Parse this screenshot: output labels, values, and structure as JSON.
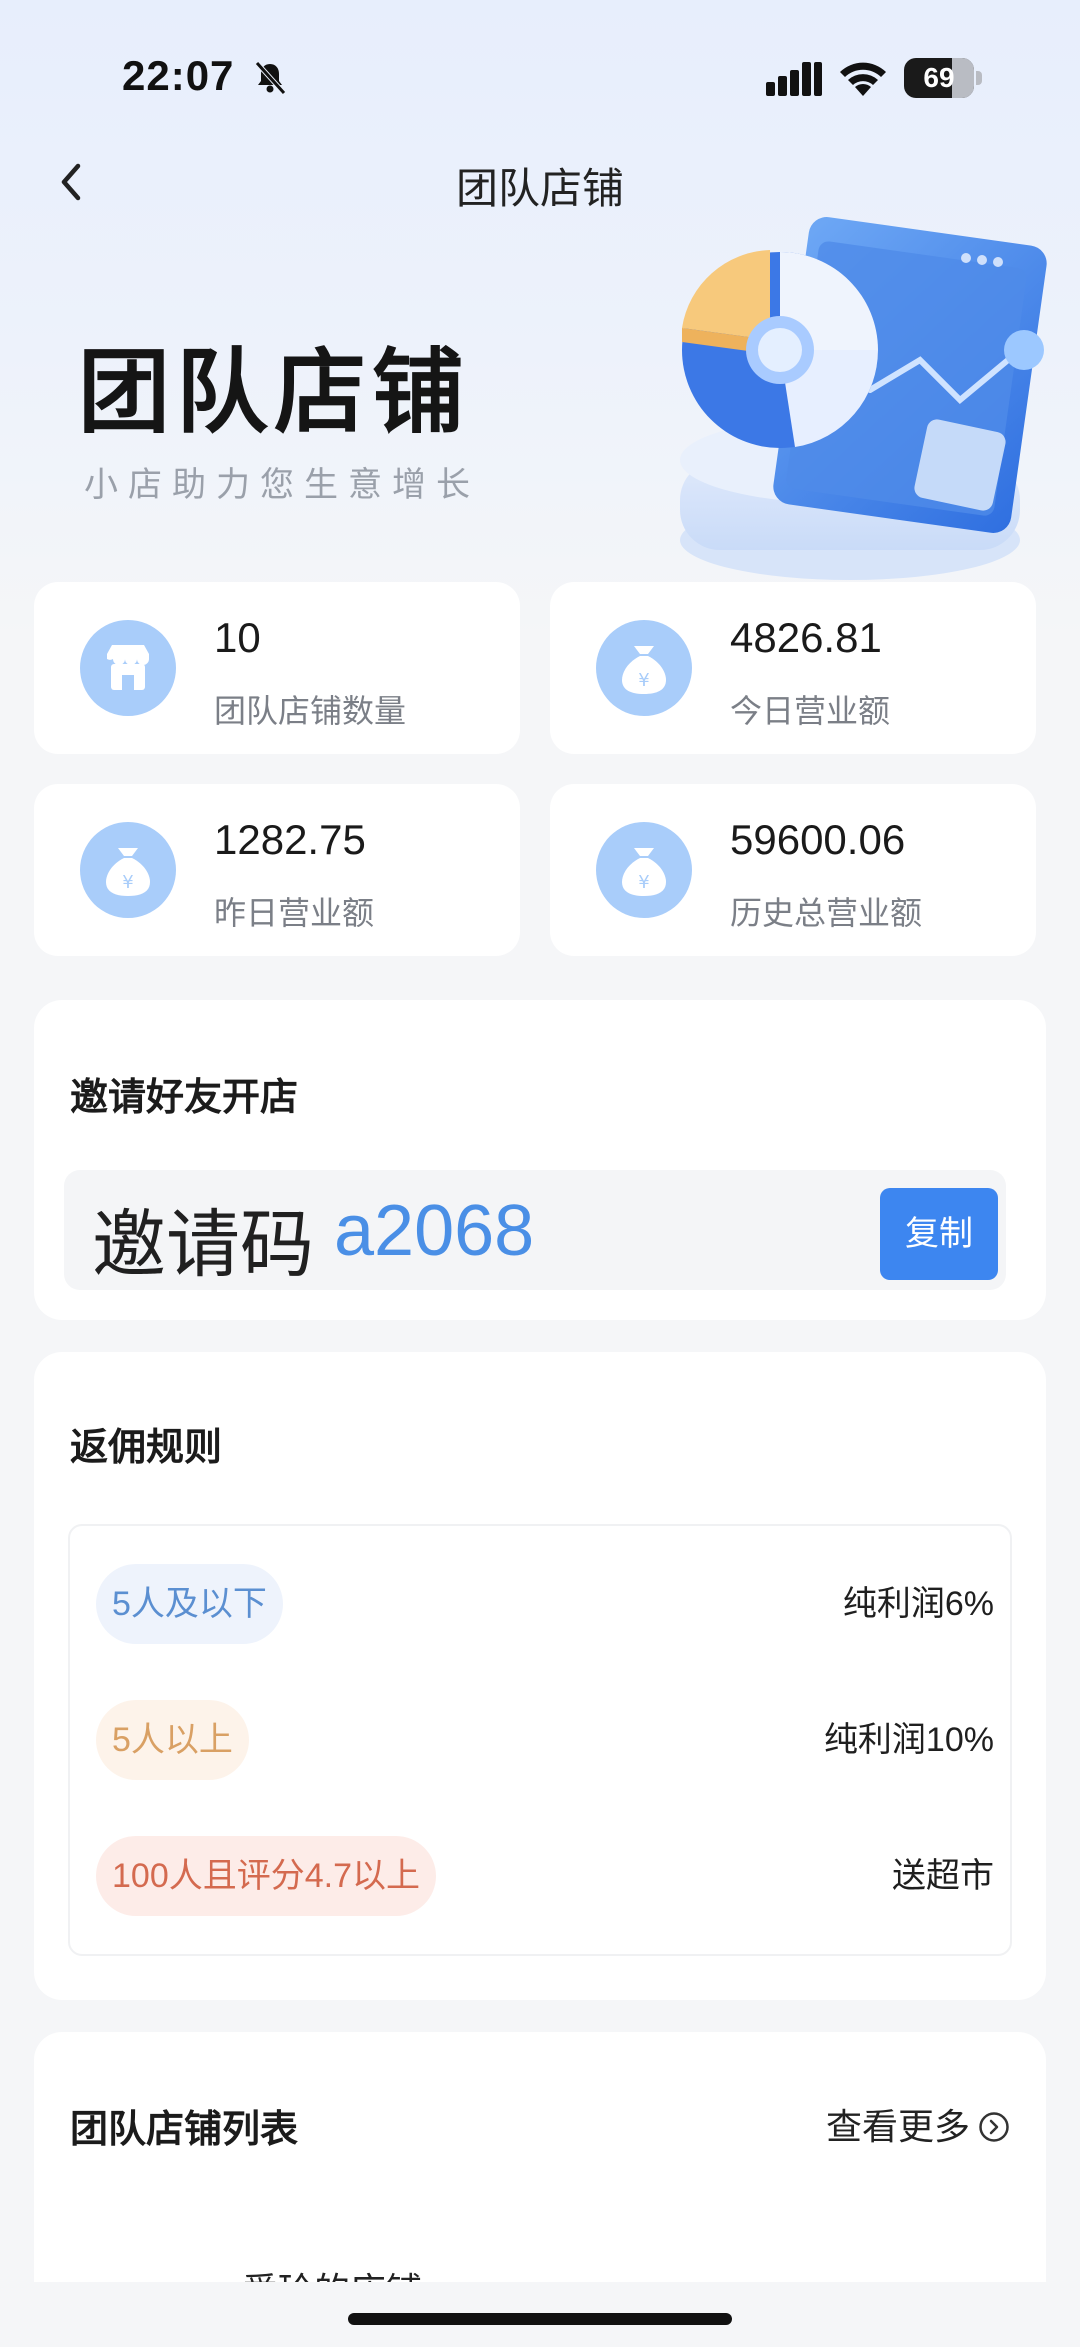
{
  "status_bar": {
    "time": "22:07",
    "battery": "69",
    "battery_level": 0.69
  },
  "nav": {
    "title": "团队店铺"
  },
  "hero": {
    "title": "团队店铺",
    "subtitle": "小店助力您生意增长"
  },
  "stats": [
    {
      "value": "10",
      "label": "团队店铺数量",
      "icon": "store-icon"
    },
    {
      "value": "4826.81",
      "label": "今日营业额",
      "icon": "money-bag-icon"
    },
    {
      "value": "1282.75",
      "label": "昨日营业额",
      "icon": "money-bag-icon"
    },
    {
      "value": "59600.06",
      "label": "历史总营业额",
      "icon": "money-bag-icon"
    }
  ],
  "invite": {
    "title": "邀请好友开店",
    "label": "邀请码",
    "code": "a2068",
    "copy_label": "复制"
  },
  "rules": {
    "title": "返佣规则",
    "rows": [
      {
        "tag": "5人及以下",
        "value": "纯利润6%",
        "tag_color": "#5b8fd1",
        "tag_bg": "#eef3fc"
      },
      {
        "tag": "5人以上",
        "value": "纯利润10%",
        "tag_color": "#d9a064",
        "tag_bg": "#fdf3ea"
      },
      {
        "tag": "100人且评分4.7以上",
        "value": "送超市",
        "tag_color": "#d46a4f",
        "tag_bg": "#fdece8"
      }
    ]
  },
  "store_list": {
    "title": "团队店铺列表",
    "more_label": "查看更多",
    "items": [
      "爱玲的店铺"
    ]
  },
  "colors": {
    "accent": "#3d86f0",
    "code": "#4a8fe6",
    "icon_circle": "#a9cdfa"
  }
}
